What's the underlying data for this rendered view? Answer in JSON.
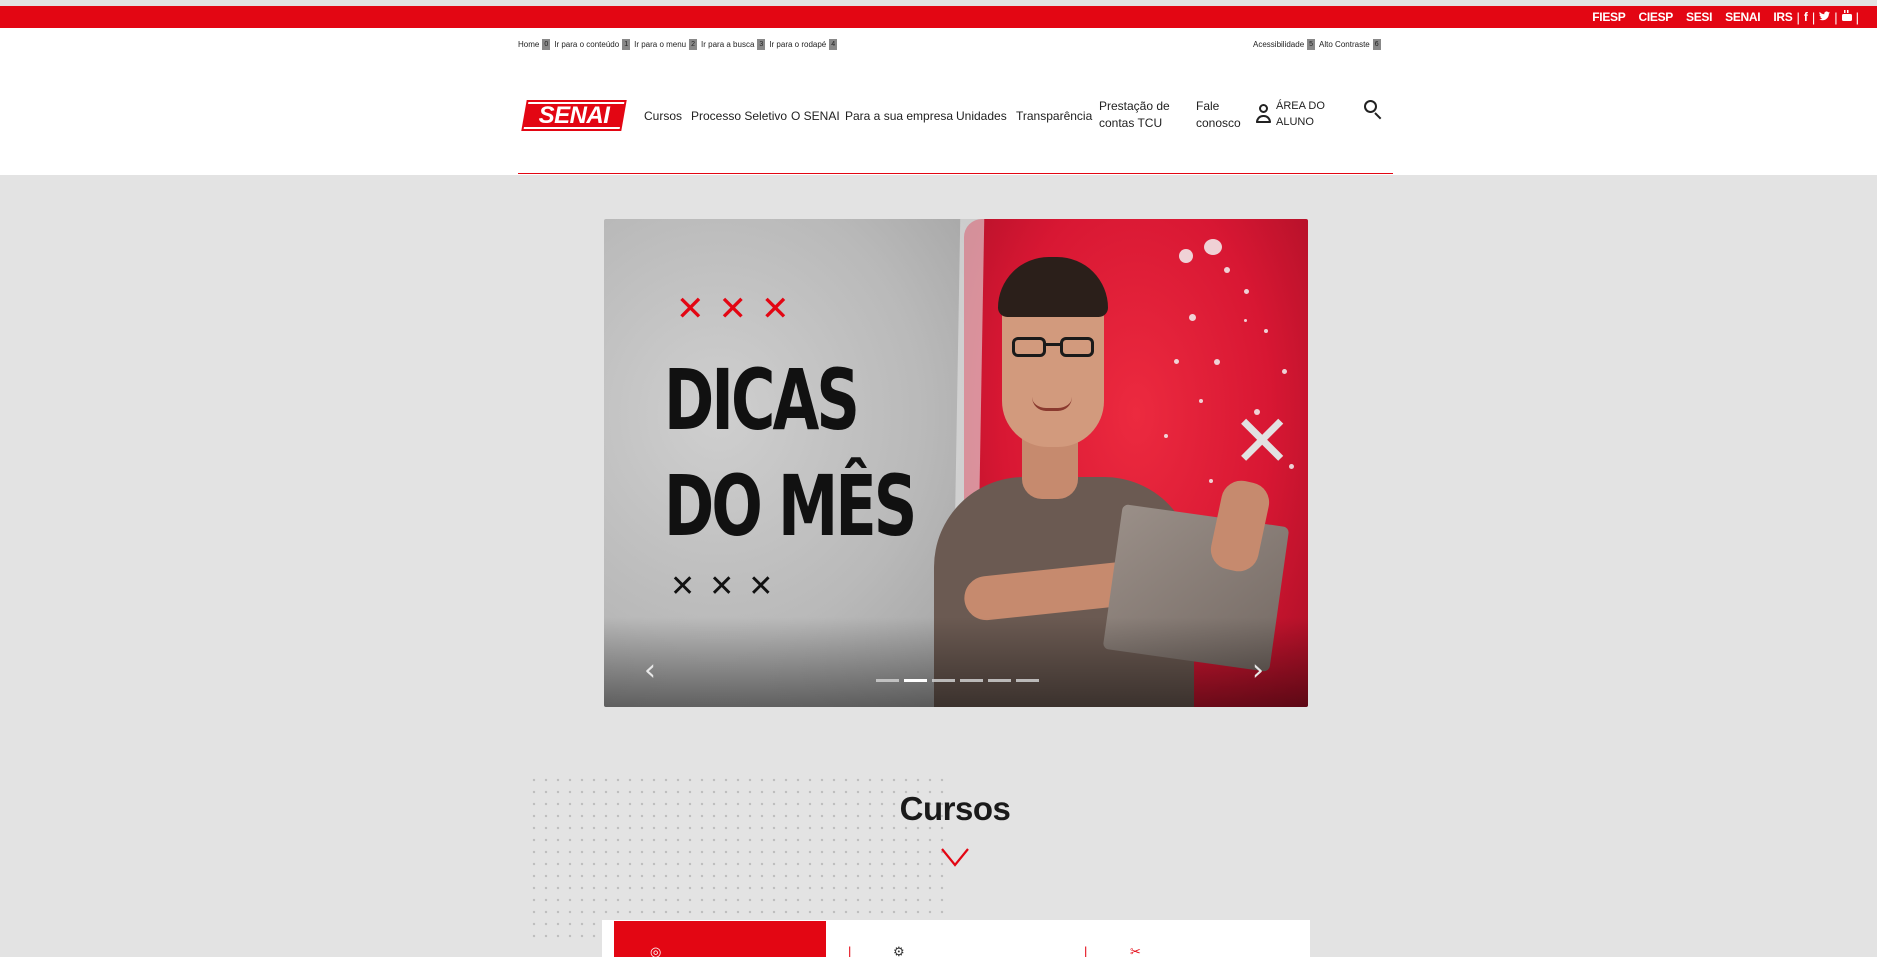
{
  "topbar": {
    "links": [
      "FIESP",
      "CIESP",
      "SESI",
      "SENAI",
      "IRS"
    ],
    "social": [
      {
        "icon": "facebook-icon",
        "glyph": "f"
      },
      {
        "icon": "twitter-icon",
        "glyph": "☀"
      },
      {
        "icon": "youtube-icon",
        "glyph": "▶"
      }
    ],
    "color": "#e30613"
  },
  "skiplinks": {
    "left": [
      {
        "label": "Home",
        "key": "0"
      },
      {
        "label": "Ir para o conteúdo",
        "key": "1"
      },
      {
        "label": "Ir para o menu",
        "key": "2"
      },
      {
        "label": "Ir para a busca",
        "key": "3"
      },
      {
        "label": "Ir para o rodapé",
        "key": "4"
      }
    ],
    "right": [
      {
        "label": "Acessibilidade",
        "key": "5"
      },
      {
        "label": "Alto Contraste",
        "key": "6"
      }
    ]
  },
  "header": {
    "logo_text": "SENAI",
    "nav": [
      {
        "label": "Cursos"
      },
      {
        "label": "Processo Seletivo"
      },
      {
        "label": "O SENAI"
      },
      {
        "label": "Para a sua empresa"
      },
      {
        "label": "Unidades"
      },
      {
        "label": "Transparência"
      },
      {
        "label": "Prestação de contas TCU"
      },
      {
        "label": "Fale conosco"
      }
    ],
    "area_aluno": "ÁREA DO ALUNO",
    "search_icon": "search-icon"
  },
  "banner": {
    "title_line1": "DICAS",
    "title_line2": "DO MÊS",
    "marks": "✕✕✕",
    "slide_count": 6,
    "active_slide": 2,
    "prev": "‹",
    "next": "›"
  },
  "cursos": {
    "title": "Cursos"
  }
}
